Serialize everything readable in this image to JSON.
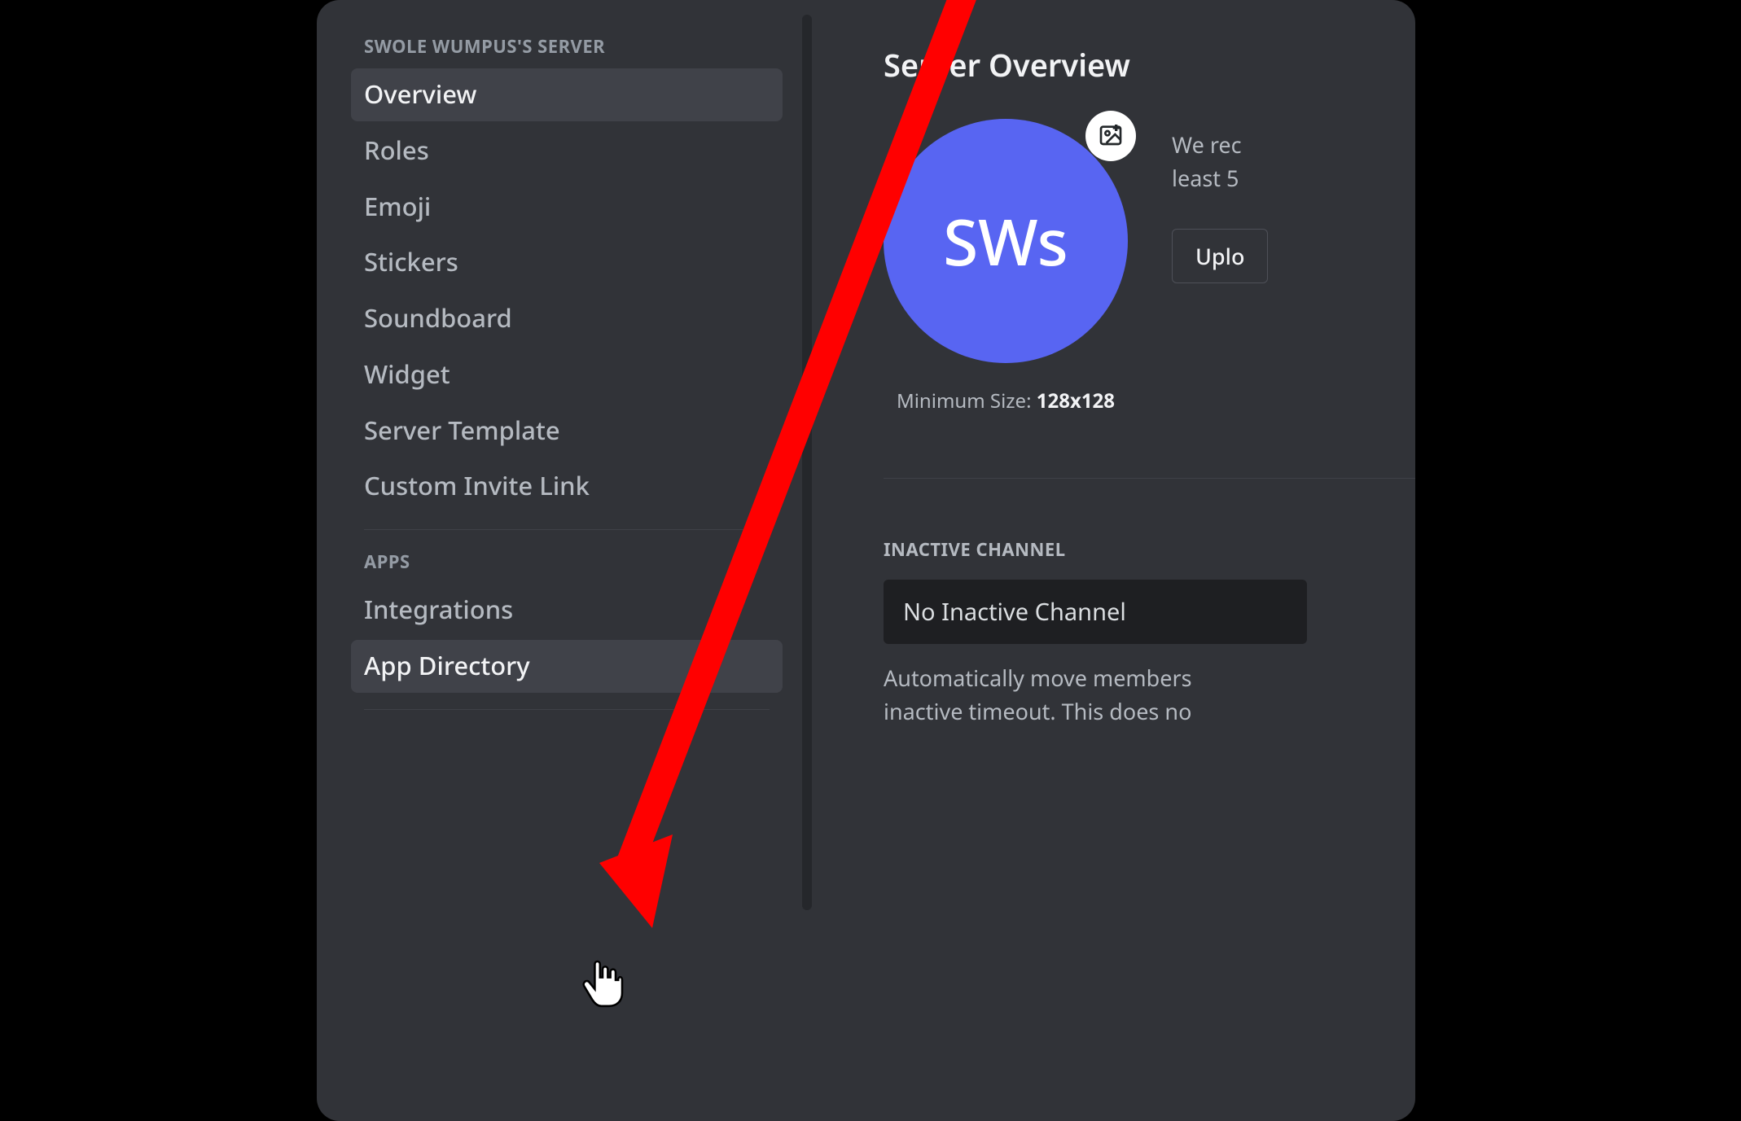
{
  "sidebar": {
    "section1_title": "SWOLE WUMPUS'S SERVER",
    "section2_title": "APPS",
    "items1": [
      {
        "label": "Overview",
        "state": "selected"
      },
      {
        "label": "Roles",
        "state": ""
      },
      {
        "label": "Emoji",
        "state": ""
      },
      {
        "label": "Stickers",
        "state": ""
      },
      {
        "label": "Soundboard",
        "state": ""
      },
      {
        "label": "Widget",
        "state": ""
      },
      {
        "label": "Server Template",
        "state": ""
      },
      {
        "label": "Custom Invite Link",
        "state": ""
      }
    ],
    "items2": [
      {
        "label": "Integrations",
        "state": ""
      },
      {
        "label": "App Directory",
        "state": "hover"
      }
    ]
  },
  "content": {
    "title": "Server Overview",
    "server_initials": "SWs",
    "min_size_prefix": "Minimum Size: ",
    "min_size_value": "128x128",
    "recommend_line1": "We rec",
    "recommend_line2": "least 5",
    "upload_button": "Uplo",
    "inactive_label": "INACTIVE CHANNEL",
    "inactive_value": "No Inactive Channel",
    "inactive_help_line1": "Automatically move members",
    "inactive_help_line2": "inactive timeout. This does no"
  }
}
